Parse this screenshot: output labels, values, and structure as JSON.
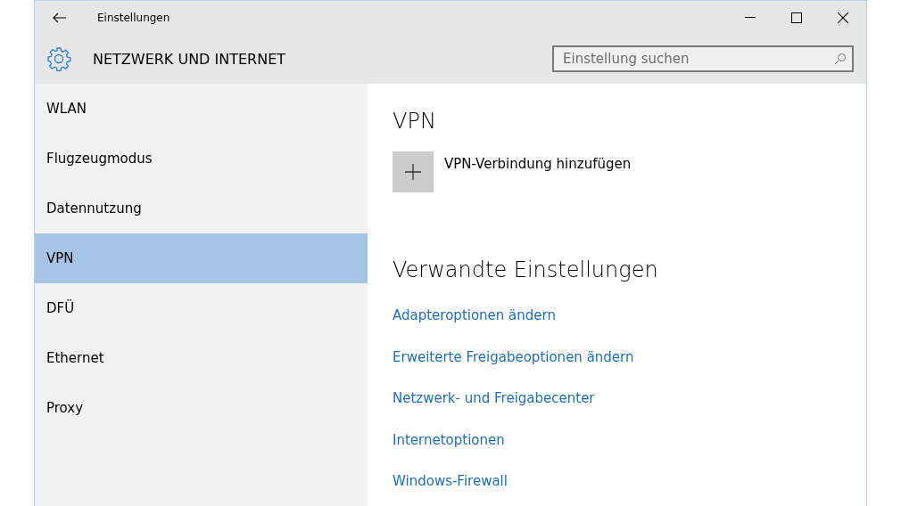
{
  "window": {
    "title": "Einstellungen"
  },
  "header": {
    "title": "NETZWERK UND INTERNET",
    "search": {
      "placeholder": "Einstellung suchen"
    }
  },
  "sidebar": {
    "items": [
      {
        "label": "WLAN",
        "selected": false
      },
      {
        "label": "Flugzeugmodus",
        "selected": false
      },
      {
        "label": "Datennutzung",
        "selected": false
      },
      {
        "label": "VPN",
        "selected": true
      },
      {
        "label": "DFÜ",
        "selected": false
      },
      {
        "label": "Ethernet",
        "selected": false
      },
      {
        "label": "Proxy",
        "selected": false
      }
    ]
  },
  "content": {
    "title": "VPN",
    "add_label": "VPN-Verbindung hinzufügen",
    "related_title": "Verwandte Einstellungen",
    "links": [
      "Adapteroptionen ändern",
      "Erweiterte Freigabeoptionen ändern",
      "Netzwerk- und Freigabecenter",
      "Internetoptionen",
      "Windows-Firewall"
    ]
  }
}
